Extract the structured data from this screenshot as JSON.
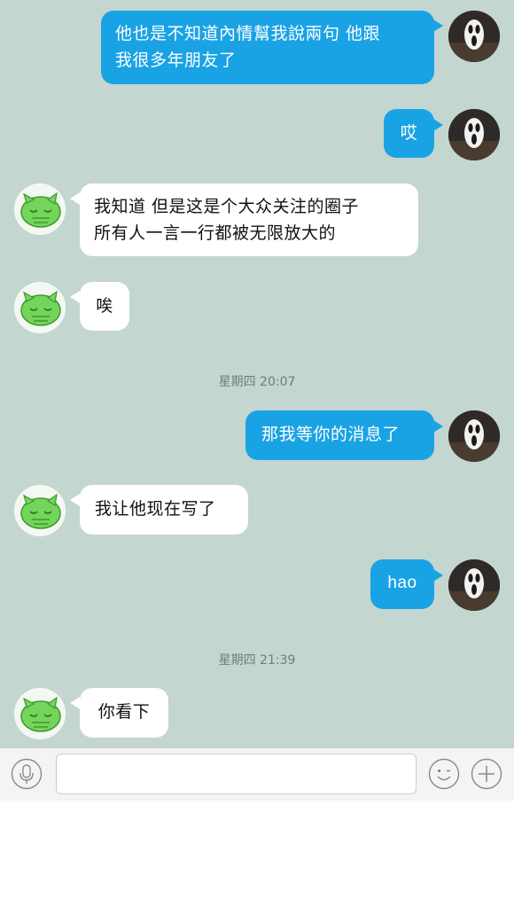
{
  "input": {
    "placeholder": "",
    "value": ""
  },
  "messages": [
    {
      "side": "right",
      "lines": [
        "他也是不知道內情幫我說兩句 他跟",
        "我很多年朋友了"
      ]
    },
    {
      "side": "right",
      "lines": [
        "哎"
      ]
    },
    {
      "side": "left",
      "lines": [
        "我知道 但是这是个大众关注的圈子",
        "所有人一言一行都被无限放大的"
      ]
    },
    {
      "side": "left",
      "lines": [
        "唉"
      ]
    },
    {
      "timestamp": "星期四 20:07"
    },
    {
      "side": "right",
      "lines": [
        "那我等你的消息了"
      ]
    },
    {
      "side": "left",
      "lines": [
        "我让他现在写了"
      ]
    },
    {
      "side": "right",
      "lines": [
        "hao"
      ]
    },
    {
      "timestamp": "星期四 21:39"
    },
    {
      "side": "left",
      "lines": [
        "你看下"
      ]
    }
  ],
  "icons": {
    "voice": "microphone-icon",
    "emoji": "smiley-face-icon",
    "more": "plus-icon",
    "self_avatar": "scream-mask-avatar",
    "contact_avatar": "green-cat-avatar"
  },
  "colors": {
    "chat_background": "#c3d6d0",
    "outgoing_bubble": "#1aa3e4",
    "incoming_bubble": "#ffffff"
  }
}
